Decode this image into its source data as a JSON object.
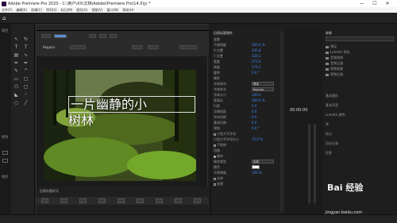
{
  "window": {
    "title": "Adobe Premiere Pro 2020 - C:\\用户\\XX\\文档\\Adobe\\Premiere Pro\\14.0\\jy *",
    "minimize": "—",
    "maximize": "☐",
    "close": "✕"
  },
  "menu": [
    "文件(F)",
    "编辑(E)",
    "剪辑(C)",
    "序列(S)",
    "标记(M)",
    "图形(G)",
    "视图(V)",
    "窗口(W)",
    "帮助(H)"
  ],
  "dialog": {
    "font_value": "Regular",
    "overlay_line1": "一片幽静的小",
    "overlay_line2": "树林",
    "bottom_title": "旧版标题样式"
  },
  "left_panel": {
    "title": "项目",
    "labels": [
      "序列",
      "项目"
    ]
  },
  "properties": {
    "title": "旧版标题属性",
    "rows": [
      {
        "label": "变换",
        "value": ""
      },
      {
        "label": "不透明度",
        "value": "100.0 %"
      },
      {
        "label": "X 位置",
        "value": "245.8"
      },
      {
        "label": "Y 位置",
        "value": "338.1"
      },
      {
        "label": "宽度",
        "value": "573.4"
      },
      {
        "label": "高度",
        "value": "173.1"
      },
      {
        "label": "旋转",
        "value": "0.0 °"
      },
      {
        "label": "属性",
        "value": ""
      },
      {
        "label": "字体系列",
        "value": "黑体"
      },
      {
        "label": "字体样式",
        "value": "Regular"
      },
      {
        "label": "字体大小",
        "value": "100.0"
      },
      {
        "label": "宽高比",
        "value": "100.0 %"
      },
      {
        "label": "行距",
        "value": "0.0"
      },
      {
        "label": "字偶间距",
        "value": "0.0"
      },
      {
        "label": "字符间距",
        "value": "0.0"
      },
      {
        "label": "基线位移",
        "value": "0.0"
      },
      {
        "label": "倾斜",
        "value": "0.0 °"
      },
      {
        "label": "小型大写字母",
        "value": ""
      },
      {
        "label": "小型大写字母大小",
        "value": "75.0 %"
      },
      {
        "label": "下划线",
        "value": ""
      },
      {
        "label": "扭曲",
        "value": ""
      },
      {
        "label": "填充",
        "value": ""
      },
      {
        "label": "填充类型",
        "value": "实底"
      },
      {
        "label": "颜色",
        "value": ""
      },
      {
        "label": "不透明度",
        "value": "100 %"
      },
      {
        "label": "光泽",
        "value": ""
      },
      {
        "label": "纹理",
        "value": ""
      }
    ]
  },
  "timeline": {
    "timecode": "00:00:00"
  },
  "right_panel": {
    "title": "效果",
    "tree": [
      "预设",
      "Lumetri 预设",
      "音频效果",
      "音频过渡",
      "视频效果",
      "视频过渡"
    ],
    "items": [
      "基本图形",
      "基本声音",
      "Lumetri 颜色",
      "库",
      "标记",
      "历史记录",
      "信息"
    ]
  },
  "watermark": {
    "text": "Bai 经验",
    "url": "jingyan.baidu.com"
  }
}
